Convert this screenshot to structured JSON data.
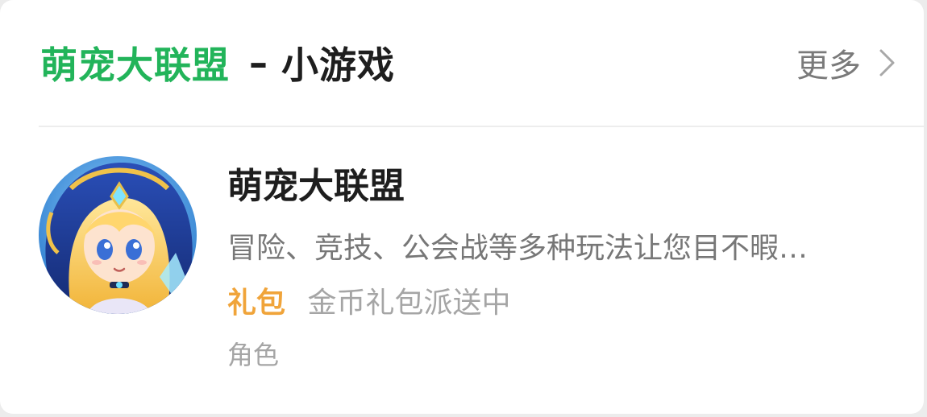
{
  "header": {
    "title_brand": "萌宠大联盟",
    "title_separator": "–",
    "title_suffix": "小游戏",
    "more_label": "更多",
    "more_icon": "chevron-right-icon"
  },
  "game": {
    "name": "萌宠大联盟",
    "description": "冒险、竞技、公会战等多种玩法让您目不暇…",
    "gift_tag": "礼包",
    "gift_text": "金币礼包派送中",
    "category": "角色",
    "avatar": "game-avatar-anime-girl"
  },
  "colors": {
    "brand_green": "#22b45a",
    "gift_orange": "#f0a43a",
    "title_text": "#1e1e1e",
    "secondary_text": "#777777",
    "muted_text": "#a5a5a5"
  }
}
